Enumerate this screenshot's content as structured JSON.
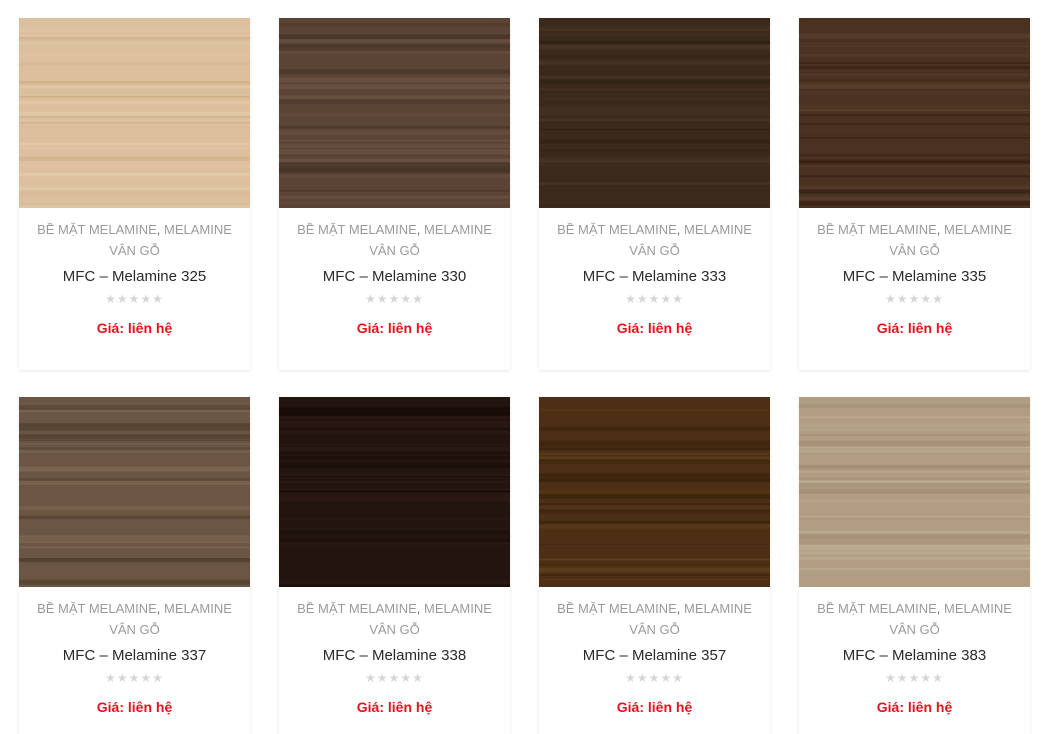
{
  "products": [
    {
      "cat1": "Bề mặt Melamine",
      "sep": ",",
      "cat2": "Melamine vân gỗ",
      "title": "MFC – Melamine 325",
      "price": "Giá: liên hệ",
      "rating_icon": "star-rating-icon",
      "rating": 0,
      "swatch": {
        "base": "#dcc09e",
        "dark": "#cfae88",
        "light": "#e6cdad"
      }
    },
    {
      "cat1": "Bề mặt Melamine",
      "sep": ",",
      "cat2": "Melamine vân gỗ",
      "title": "MFC – Melamine 330",
      "price": "Giá: liên hệ",
      "rating_icon": "star-rating-icon",
      "rating": 0,
      "swatch": {
        "base": "#5a4435",
        "dark": "#3f2e23",
        "light": "#6e5645"
      }
    },
    {
      "cat1": "Bề mặt Melamine",
      "sep": ",",
      "cat2": "Melamine vân gỗ",
      "title": "MFC – Melamine 333",
      "price": "Giá: liên hệ",
      "rating_icon": "star-rating-icon",
      "rating": 0,
      "swatch": {
        "base": "#3b2a1c",
        "dark": "#281c12",
        "light": "#4b3826"
      }
    },
    {
      "cat1": "Bề mặt Melamine",
      "sep": ",",
      "cat2": "Melamine vân gỗ",
      "title": "MFC – Melamine 335",
      "price": "Giá: liên hệ",
      "rating_icon": "star-rating-icon",
      "rating": 0,
      "swatch": {
        "base": "#4a3120",
        "dark": "#361f12",
        "light": "#5e4330"
      }
    },
    {
      "cat1": "Bề mặt Melamine",
      "sep": ",",
      "cat2": "Melamine vân gỗ",
      "title": "MFC – Melamine 337",
      "price": "Giá: liên hệ",
      "rating_icon": "star-rating-icon",
      "rating": 0,
      "swatch": {
        "base": "#6a5643",
        "dark": "#4f3e2f",
        "light": "#7d6953"
      }
    },
    {
      "cat1": "Bề mặt Melamine",
      "sep": ",",
      "cat2": "Melamine vân gỗ",
      "title": "MFC – Melamine 338",
      "price": "Giá: liên hệ",
      "rating_icon": "star-rating-icon",
      "rating": 0,
      "swatch": {
        "base": "#22140f",
        "dark": "#150b08",
        "light": "#2e1c15"
      }
    },
    {
      "cat1": "Bề mặt Melamine",
      "sep": ",",
      "cat2": "Melamine vân gỗ",
      "title": "MFC – Melamine 357",
      "price": "Giá: liên hệ",
      "rating_icon": "star-rating-icon",
      "rating": 0,
      "swatch": {
        "base": "#4c2f14",
        "dark": "#36200b",
        "light": "#60401f"
      }
    },
    {
      "cat1": "Bề mặt Melamine",
      "sep": ",",
      "cat2": "Melamine vân gỗ",
      "title": "MFC – Melamine 383",
      "price": "Giá: liên hệ",
      "rating_icon": "star-rating-icon",
      "rating": 0,
      "swatch": {
        "base": "#b09d83",
        "dark": "#9e8b72",
        "light": "#c0ae95"
      }
    }
  ],
  "colors": {
    "category_text": "#9a9a9a",
    "title_text": "#2a2a2a",
    "price_text": "#e4141e",
    "star_empty": "#d6d6d6"
  }
}
